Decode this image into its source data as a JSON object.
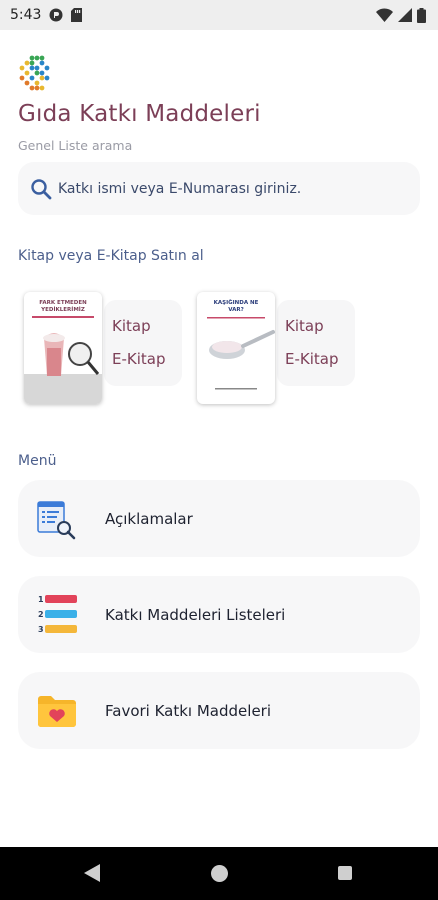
{
  "status_bar": {
    "time": "5:43"
  },
  "app": {
    "title": "Gıda Katkı Maddeleri",
    "subtitle": "Genel Liste arama"
  },
  "search": {
    "placeholder": "Katkı ismi veya E-Numarası giriniz."
  },
  "buy_section": {
    "title": "Kitap veya E-Kitap Satın al",
    "books": [
      {
        "cover_title": "FARK ETMEDEN YEDİKLERİMİZ",
        "kitap_label": "Kitap",
        "ekitap_label": "E-Kitap"
      },
      {
        "cover_title": "KAŞIĞINDA NE VAR?",
        "kitap_label": "Kitap",
        "ekitap_label": "E-Kitap"
      }
    ]
  },
  "menu": {
    "title": "Menü",
    "items": [
      {
        "label": "Açıklamalar",
        "icon": "document-search-icon"
      },
      {
        "label": "Katkı Maddeleri Listeleri",
        "icon": "numbered-list-icon"
      },
      {
        "label": "Favori Katkı Maddeleri",
        "icon": "favorite-folder-icon"
      }
    ]
  },
  "colors": {
    "title": "#7c3f57",
    "section": "#4c5f8c",
    "card_bg": "#f7f7f8"
  }
}
